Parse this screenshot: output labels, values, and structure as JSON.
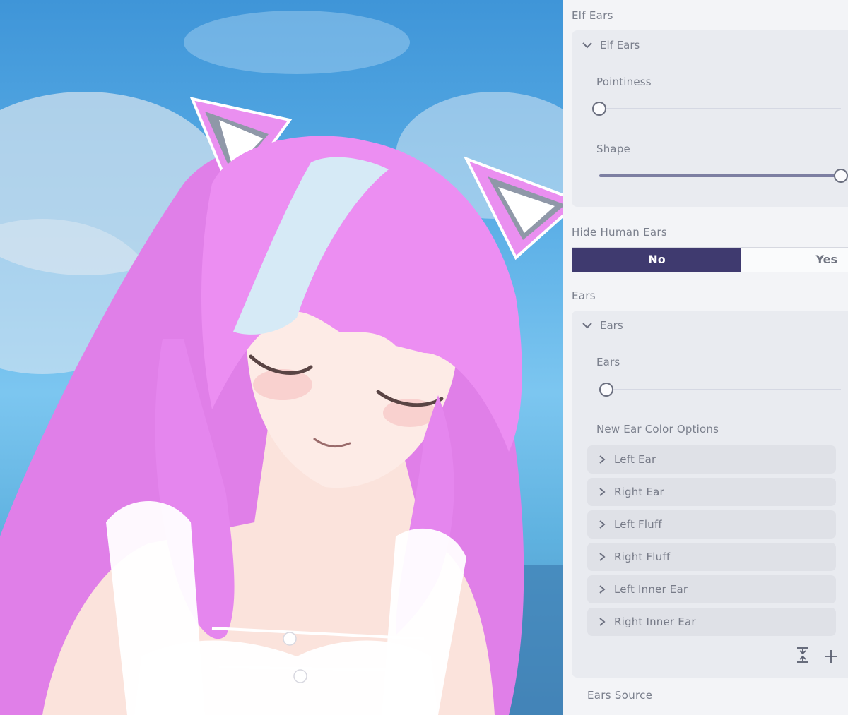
{
  "panel": {
    "elf_section_title": "Elf Ears",
    "elf_card": {
      "header": "Elf Ears",
      "pointiness": {
        "label": "Pointiness",
        "value": 0.0
      },
      "shape": {
        "label": "Shape",
        "value": 1.0
      }
    },
    "hide_human_ears": {
      "label": "Hide Human Ears",
      "options": [
        "No",
        "Yes"
      ],
      "selected": "No"
    },
    "ears_section_title": "Ears",
    "ears_card": {
      "header": "Ears",
      "ears_slider": {
        "label": "Ears",
        "value": 0.03
      },
      "color_options_label": "New Ear Color Options",
      "color_items": [
        "Left Ear",
        "Right Ear",
        "Left Fluff",
        "Right Fluff",
        "Left Inner Ear",
        "Right Inner Ear"
      ]
    },
    "ears_source_label": "Ears Source",
    "icons": {
      "collapse": "collapse-all-icon",
      "add": "plus-icon",
      "chevron": "chevron-icon"
    },
    "colors": {
      "toggle_active": "#3f3a6f",
      "slider_fill": "#7d7fa2",
      "text": "#7a7f8c"
    }
  },
  "viewport": {
    "scene": "avatar-preview",
    "colors": {
      "hair": "#e887f0",
      "hair_streak": "#cfe6f5",
      "sky": "#5aaee6",
      "skin": "#fdebe6"
    }
  }
}
